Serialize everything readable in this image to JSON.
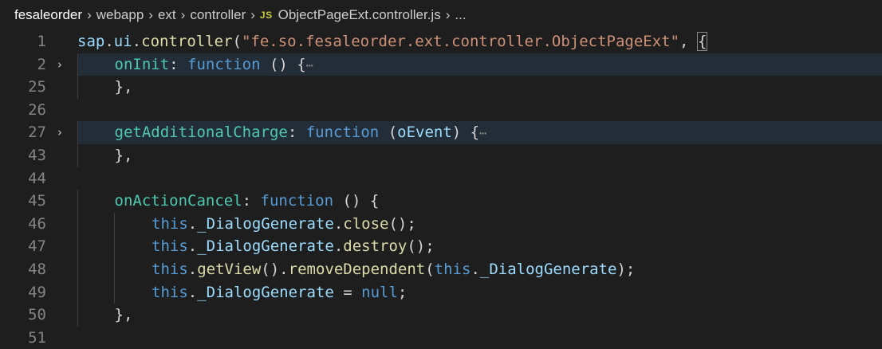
{
  "breadcrumb": {
    "items": [
      "fesaleorder",
      "webapp",
      "ext",
      "controller"
    ],
    "file_icon": "JS",
    "file_name": "ObjectPageExt.controller.js",
    "more": "...",
    "separator": "›"
  },
  "editor": {
    "fold_glyph": "›",
    "ellipsis": "⋯",
    "lines": [
      {
        "num": "1",
        "indent": 0,
        "fold": false,
        "tokens": [
          [
            "var",
            "sap"
          ],
          [
            "punc",
            "."
          ],
          [
            "var",
            "ui"
          ],
          [
            "punc",
            "."
          ],
          [
            "fn",
            "controller"
          ],
          [
            "punc",
            "("
          ],
          [
            "str",
            "\"fe.so.fesaleorder.ext.controller.ObjectPageExt\""
          ],
          [
            "punc",
            ", "
          ],
          [
            "punc",
            "{"
          ]
        ]
      },
      {
        "num": "2",
        "indent": 1,
        "fold": true,
        "tokens": [
          [
            "prop",
            "onInit"
          ],
          [
            "punc",
            ": "
          ],
          [
            "kw",
            "function"
          ],
          [
            "punc",
            " () {"
          ]
        ]
      },
      {
        "num": "25",
        "indent": 1,
        "fold": false,
        "tokens": [
          [
            "punc",
            "},"
          ]
        ]
      },
      {
        "num": "26",
        "indent": 0,
        "fold": false,
        "tokens": []
      },
      {
        "num": "27",
        "indent": 1,
        "fold": true,
        "tokens": [
          [
            "prop",
            "getAdditionalCharge"
          ],
          [
            "punc",
            ": "
          ],
          [
            "kw",
            "function"
          ],
          [
            "punc",
            " ("
          ],
          [
            "var",
            "oEvent"
          ],
          [
            "punc",
            ") {"
          ]
        ]
      },
      {
        "num": "43",
        "indent": 1,
        "fold": false,
        "tokens": [
          [
            "punc",
            "},"
          ]
        ]
      },
      {
        "num": "44",
        "indent": 0,
        "fold": false,
        "tokens": []
      },
      {
        "num": "45",
        "indent": 1,
        "fold": false,
        "tokens": [
          [
            "prop",
            "onActionCancel"
          ],
          [
            "punc",
            ": "
          ],
          [
            "kw",
            "function"
          ],
          [
            "punc",
            " () {"
          ]
        ]
      },
      {
        "num": "46",
        "indent": 2,
        "fold": false,
        "tokens": [
          [
            "kw",
            "this"
          ],
          [
            "punc",
            "."
          ],
          [
            "var",
            "_DialogGenerate"
          ],
          [
            "punc",
            "."
          ],
          [
            "fn",
            "close"
          ],
          [
            "punc",
            "();"
          ]
        ]
      },
      {
        "num": "47",
        "indent": 2,
        "fold": false,
        "tokens": [
          [
            "kw",
            "this"
          ],
          [
            "punc",
            "."
          ],
          [
            "var",
            "_DialogGenerate"
          ],
          [
            "punc",
            "."
          ],
          [
            "fn",
            "destroy"
          ],
          [
            "punc",
            "();"
          ]
        ]
      },
      {
        "num": "48",
        "indent": 2,
        "fold": false,
        "tokens": [
          [
            "kw",
            "this"
          ],
          [
            "punc",
            "."
          ],
          [
            "fn",
            "getView"
          ],
          [
            "punc",
            "()."
          ],
          [
            "fn",
            "removeDependent"
          ],
          [
            "punc",
            "("
          ],
          [
            "kw",
            "this"
          ],
          [
            "punc",
            "."
          ],
          [
            "var",
            "_DialogGenerate"
          ],
          [
            "punc",
            ");"
          ]
        ]
      },
      {
        "num": "49",
        "indent": 2,
        "fold": false,
        "tokens": [
          [
            "kw",
            "this"
          ],
          [
            "punc",
            "."
          ],
          [
            "var",
            "_DialogGenerate"
          ],
          [
            "punc",
            " = "
          ],
          [
            "kw",
            "null"
          ],
          [
            "punc",
            ";"
          ]
        ]
      },
      {
        "num": "50",
        "indent": 1,
        "fold": false,
        "tokens": [
          [
            "punc",
            "},"
          ]
        ]
      },
      {
        "num": "51",
        "indent": 0,
        "fold": false,
        "tokens": []
      }
    ]
  },
  "colors": {
    "background": "#1e1e1e",
    "keyword": "#569cd6",
    "string": "#ce9178",
    "function": "#dcdcaa",
    "property": "#4ec9b0",
    "variable": "#9cdcfe",
    "line_number": "#858585",
    "js_icon": "#cbcb41"
  }
}
